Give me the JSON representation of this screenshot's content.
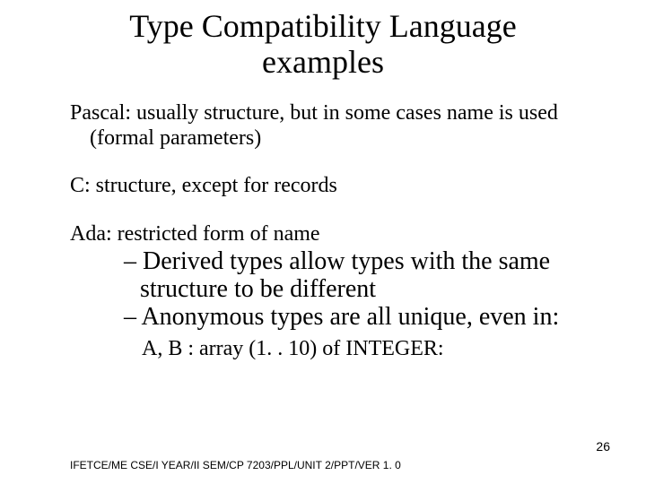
{
  "title_line1": "Type Compatibility Language",
  "title_line2": "examples",
  "pascal": "Pascal: usually structure, but in some cases name is used (formal parameters)",
  "c": "C: structure, except for records",
  "ada_head": "Ada: restricted form of name",
  "ada_sub1": "– Derived types allow types with the same structure to be different",
  "ada_sub2": "– Anonymous types are all unique, even in:",
  "ada_code": "A, B : array (1. . 10) of INTEGER:",
  "footer": "IFETCE/ME CSE/I YEAR/II SEM/CP 7203/PPL/UNIT 2/PPT/VER 1. 0",
  "page_number": "26"
}
